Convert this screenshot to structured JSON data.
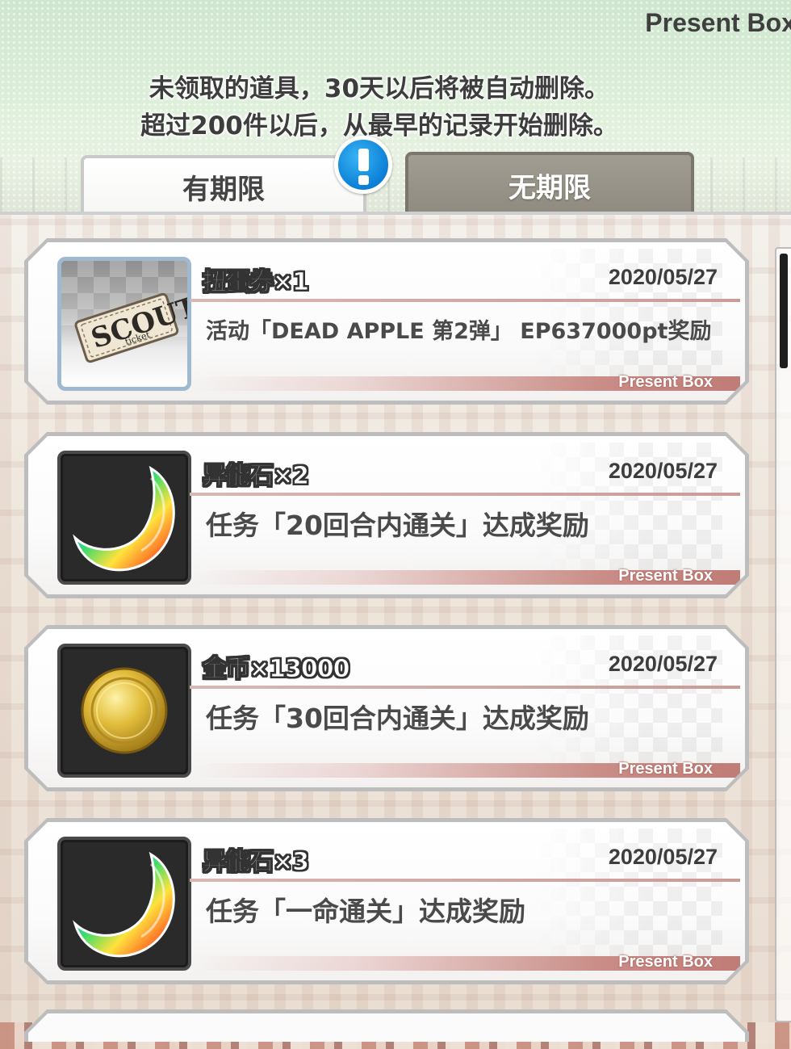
{
  "header": {
    "title": "Present Box",
    "notice_line1": "未领取的道具，30天以后将被自动删除。",
    "notice_line2": "超过200件以后，从最早的记录开始删除。"
  },
  "tabs": {
    "limited_label": "有期限",
    "unlimited_label": "无期限",
    "active": "limited"
  },
  "alert_badge": {
    "icon": "exclamation-icon",
    "color": "#1a95e6"
  },
  "presents": [
    {
      "icon": "scout-ticket-icon",
      "icon_text": "SCOUT",
      "icon_subtext": "ticket",
      "name": "扭蛋券×1",
      "date": "2020/05/27",
      "description": "活动「DEAD APPLE 第2弹」 EP637000pt奖励",
      "source_tag": "Present Box"
    },
    {
      "icon": "ability-stone-icon",
      "name": "异能石×2",
      "date": "2020/05/27",
      "description": "任务「20回合内通关」达成奖励",
      "source_tag": "Present Box"
    },
    {
      "icon": "gold-coin-icon",
      "name": "金币×13000",
      "date": "2020/05/27",
      "description": "任务「30回合内通关」达成奖励",
      "source_tag": "Present Box"
    },
    {
      "icon": "ability-stone-icon",
      "name": "异能石×3",
      "date": "2020/05/27",
      "description": "任务「一命通关」达成奖励",
      "source_tag": "Present Box"
    }
  ],
  "colors": {
    "tab_inactive": "#928d82",
    "footer_accent": "#c98c86",
    "badge_blue": "#1a95e6"
  }
}
